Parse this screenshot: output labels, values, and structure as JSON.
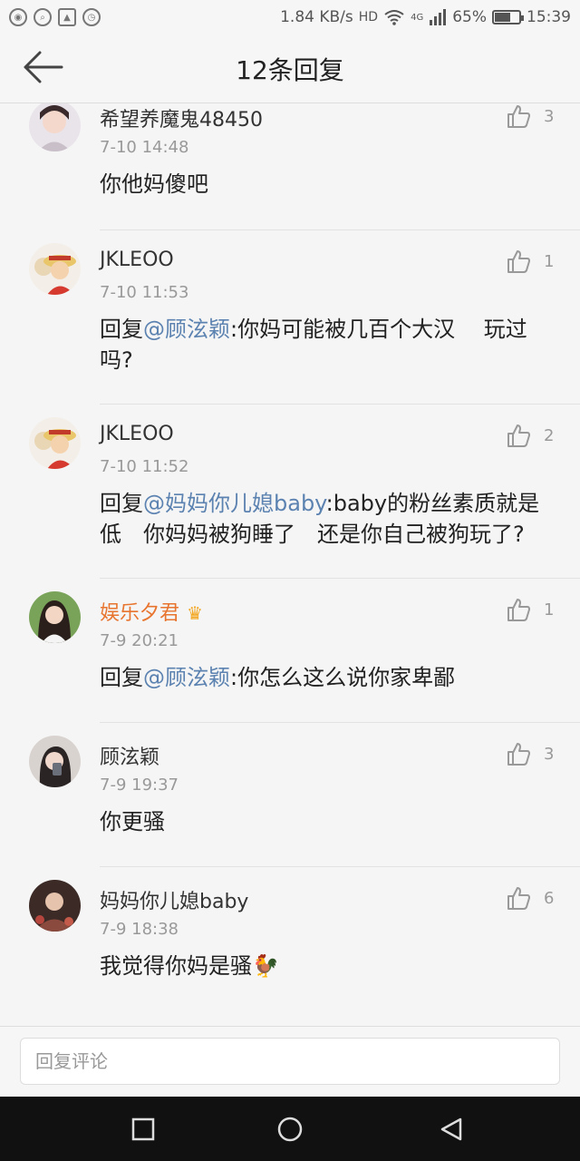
{
  "status_bar": {
    "net_speed": "1.84 KB/s",
    "network_type": "HD",
    "signal_type": "4G",
    "battery_percent": "65%",
    "battery_level": 0.65,
    "time": "15:39"
  },
  "header": {
    "title": "12条回复"
  },
  "comments": [
    {
      "username": "希望养魔鬼48450",
      "time": "7-10 14:48",
      "text": "你他妈傻吧",
      "mention": "",
      "likes": "3"
    },
    {
      "username": "JKLEOO",
      "time": "7-10 11:53",
      "prefix": "回复",
      "mention": "@顾泫颖",
      "text": ":你妈可能被几百个大汉　 玩过吗?",
      "likes": "1"
    },
    {
      "username": "JKLEOO",
      "time": "7-10 11:52",
      "prefix": "回复",
      "mention": "@妈妈你儿媳baby",
      "text": ":baby的粉丝素质就是低　你妈妈被狗睡了　还是你自己被狗玩了?",
      "likes": "2"
    },
    {
      "username": "娱乐夕君",
      "time": "7-9 20:21",
      "prefix": "回复",
      "mention": "@顾泫颖",
      "text": ":你怎么这么说你家卑鄙",
      "likes": "1",
      "vip": true
    },
    {
      "username": "顾泫颖",
      "time": "7-9 19:37",
      "text": "你更骚",
      "likes": "3"
    },
    {
      "username": "妈妈你儿媳baby",
      "time": "7-9 18:38",
      "text": "我觉得你妈是骚🐓",
      "likes": "6"
    }
  ],
  "reply_bar": {
    "placeholder": "回复评论"
  },
  "icons": {
    "back": "back-arrow-icon",
    "like": "thumbs-up-icon",
    "crown": "crown-badge-icon"
  },
  "colors": {
    "mention": "#5b82b0",
    "vip_name": "#e8752f",
    "background": "#f5f5f5"
  }
}
